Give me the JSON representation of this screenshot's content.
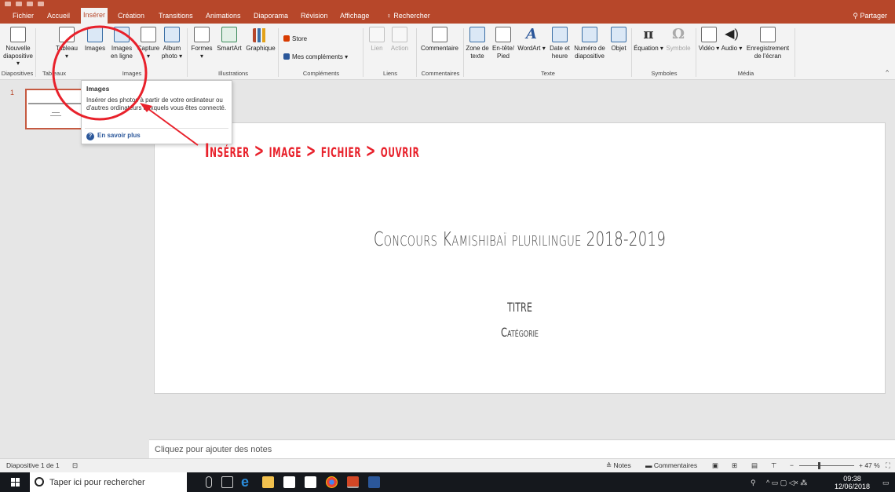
{
  "tabs": {
    "fichier": "Fichier",
    "accueil": "Accueil",
    "inserer": "Insérer",
    "creation": "Création",
    "transitions": "Transitions",
    "animations": "Animations",
    "diaporama": "Diaporama",
    "revision": "Révision",
    "affichage": "Affichage",
    "rechercher": "Rechercher",
    "partager": "Partager"
  },
  "ribbon": {
    "nouvelle_diapositive": "Nouvelle diapositive ▾",
    "tableau": "Tableau ▾",
    "images": "Images",
    "images_en_ligne": "Images en ligne",
    "capture": "Capture ▾",
    "album_photo": "Album photo ▾",
    "formes": "Formes ▾",
    "smartart": "SmartArt",
    "graphique": "Graphique",
    "store": "Store",
    "mes_complements": "Mes compléments ▾",
    "lien": "Lien",
    "action": "Action",
    "commentaire": "Commentaire",
    "zone_de_texte": "Zone de texte",
    "entete_pied": "En-tête/ Pied",
    "wordart": "WordArt ▾",
    "date_heure": "Date et heure",
    "numero_diapositive": "Numéro de diapositive",
    "objet": "Objet",
    "equation": "Équation ▾",
    "symbole": "Symbole",
    "video": "Vidéo ▾",
    "audio": "Audio ▾",
    "enregistrement": "Enregistrement de l'écran",
    "groups": {
      "diapositives": "Diapositives",
      "tableaux": "Tableaux",
      "images": "Images",
      "illustrations": "Illustrations",
      "complements": "Compléments",
      "liens": "Liens",
      "commentaires": "Commentaires",
      "texte": "Texte",
      "symboles": "Symboles",
      "media": "Média"
    }
  },
  "tooltip": {
    "title": "Images",
    "body": "Insérer des photos à partir de votre ordinateur ou d'autres ordinateurs auxquels vous êtes connecté.",
    "link": "En savoir plus"
  },
  "annotation": "Insérer > image > fichier > ouvrir",
  "slide_panel": {
    "number": "1"
  },
  "slide": {
    "title": "Concours Kamishibaï plurilingue 2018-2019",
    "subtitle1": "TITRE",
    "subtitle2": "Catégorie"
  },
  "notes_placeholder": "Cliquez pour ajouter des notes",
  "status": {
    "slide_count": "Diapositive 1 de 1",
    "notes": "Notes",
    "commentaires": "Commentaires",
    "zoom": "+ 47 %"
  },
  "taskbar": {
    "search_placeholder": "Taper ici pour rechercher",
    "time": "09:38",
    "date": "12/06/2018"
  },
  "colors": {
    "accent": "#b7472a",
    "annotation": "#e8212b"
  }
}
